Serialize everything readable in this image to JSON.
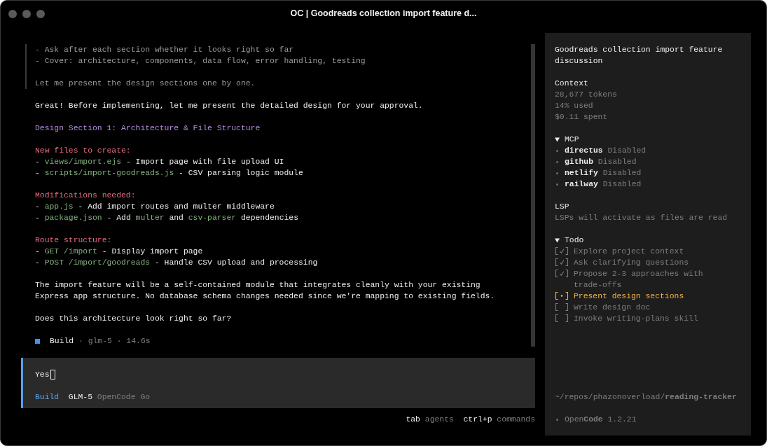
{
  "window": {
    "title": "OC | Goodreads collection import feature d..."
  },
  "transcript": {
    "reasoning": [
      [
        "- Ask after each section whether it looks right so far",
        "- Cover: architecture, components, data flow, error handling, testing"
      ],
      [
        "Let me present the design sections one by one."
      ]
    ],
    "response": [
      {
        "kind": "text",
        "text": "Great! Before implementing, let me present the detailed design for your approval."
      },
      {
        "kind": "heading",
        "text": "Design Section 1: Architecture & File Structure"
      },
      {
        "kind": "list",
        "label": "New files to create:",
        "items": [
          [
            {
              "kind": "plain",
              "text": "- "
            },
            {
              "kind": "code",
              "text": "views/import.ejs"
            },
            {
              "kind": "plain",
              "text": " - Import page with file upload UI"
            }
          ],
          [
            {
              "kind": "plain",
              "text": "- "
            },
            {
              "kind": "code",
              "text": "scripts/import-goodreads.js"
            },
            {
              "kind": "plain",
              "text": " - CSV parsing logic module"
            }
          ]
        ]
      },
      {
        "kind": "list",
        "label": "Modifications needed:",
        "items": [
          [
            {
              "kind": "plain",
              "text": "- "
            },
            {
              "kind": "code",
              "text": "app.js"
            },
            {
              "kind": "plain",
              "text": " - Add import routes and multer middleware"
            }
          ],
          [
            {
              "kind": "plain",
              "text": "- "
            },
            {
              "kind": "code",
              "text": "package.json"
            },
            {
              "kind": "plain",
              "text": " - Add "
            },
            {
              "kind": "code",
              "text": "multer"
            },
            {
              "kind": "plain",
              "text": " and "
            },
            {
              "kind": "code",
              "text": "csv-parser"
            },
            {
              "kind": "plain",
              "text": " dependencies"
            }
          ]
        ]
      },
      {
        "kind": "list",
        "label": "Route structure:",
        "items": [
          [
            {
              "kind": "plain",
              "text": "- "
            },
            {
              "kind": "code",
              "text": "GET /import"
            },
            {
              "kind": "plain",
              "text": " - Display import page"
            }
          ],
          [
            {
              "kind": "plain",
              "text": "- "
            },
            {
              "kind": "code",
              "text": "POST /import/goodreads"
            },
            {
              "kind": "plain",
              "text": " - Handle CSV upload and processing"
            }
          ]
        ]
      },
      {
        "kind": "text",
        "text": "The import feature will be a self-contained module that integrates cleanly with your existing Express app structure. No database schema changes needed since we're mapping to existing fields."
      },
      {
        "kind": "text",
        "text": "Does this architecture look right so far?"
      }
    ],
    "run": {
      "agent": "Build",
      "details": "· glm-5 · 14.6s"
    }
  },
  "prompt": {
    "value": "Yes",
    "agent": "Build",
    "model": "GLM-5",
    "provider": "OpenCode Go"
  },
  "shortcuts": [
    {
      "key": "tab",
      "label": "agents"
    },
    {
      "key": "ctrl+p",
      "label": "commands"
    }
  ],
  "sidebar": {
    "title": "Goodreads collection import feature discussion",
    "context": {
      "heading": "Context",
      "lines": [
        "28,677 tokens",
        "14% used",
        "$0.11 spent"
      ]
    },
    "mcp": {
      "heading": "MCP",
      "expanded": true,
      "servers": [
        {
          "name": "directus",
          "status": "Disabled"
        },
        {
          "name": "github",
          "status": "Disabled"
        },
        {
          "name": "netlify",
          "status": "Disabled"
        },
        {
          "name": "railway",
          "status": "Disabled"
        }
      ]
    },
    "lsp": {
      "heading": "LSP",
      "note": "LSPs will activate as files are read"
    },
    "todo": {
      "heading": "Todo",
      "expanded": true,
      "items": [
        {
          "text": "Explore project context",
          "checked": true,
          "active": false
        },
        {
          "text": "Ask clarifying questions",
          "checked": true,
          "active": false
        },
        {
          "text": "Propose 2-3 approaches with trade-offs",
          "checked": true,
          "active": false
        },
        {
          "text": "Present design sections",
          "checked": false,
          "active": true
        },
        {
          "text": "Write design doc",
          "checked": false,
          "active": false
        },
        {
          "text": "Invoke writing-plans skill",
          "checked": false,
          "active": false
        }
      ]
    },
    "path": "~/repos/phazonoverload/**reading-tracker**",
    "app": {
      "name": "Open**Code**",
      "version": "1.2.21"
    }
  }
}
